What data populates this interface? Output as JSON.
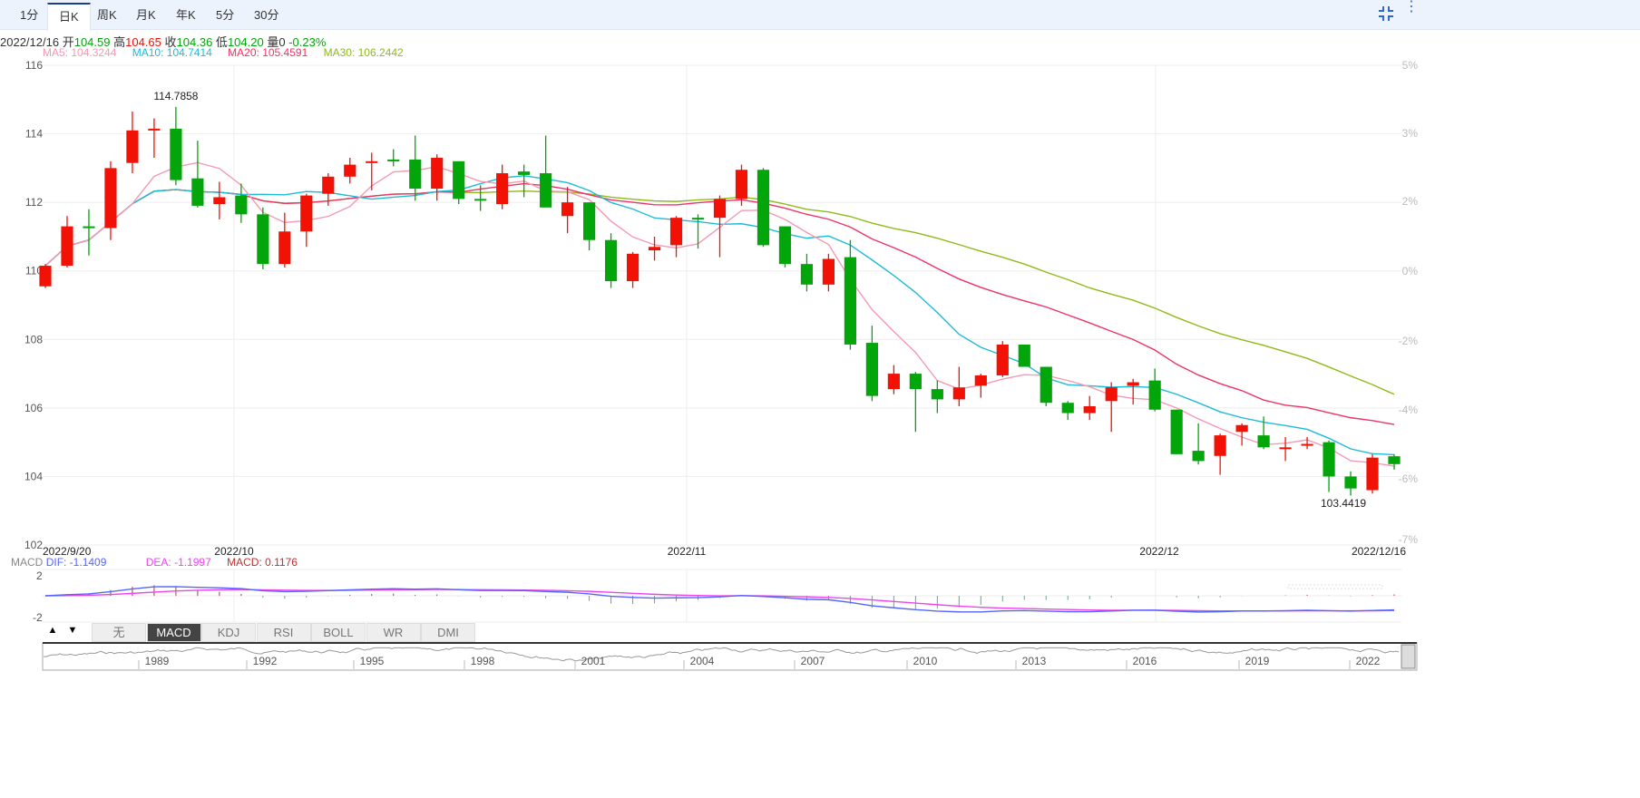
{
  "tabs": [
    "1分",
    "日K",
    "周K",
    "月K",
    "年K",
    "5分",
    "30分"
  ],
  "active_tab": "日K",
  "info": {
    "date": "2022/12/16",
    "open_label": "开",
    "open": "104.59",
    "high_label": "高",
    "high": "104.65",
    "close_label": "收",
    "close": "104.36",
    "low_label": "低",
    "low": "104.20",
    "vol_label": "量",
    "vol": "0",
    "change": "-0.23%"
  },
  "ma": {
    "ma5": "MA5: 104.3244",
    "ma10": "MA10: 104.7414",
    "ma20": "MA20: 105.4591",
    "ma30": "MA30: 106.2442"
  },
  "colors": {
    "up": "#f21205",
    "down": "#02a60b",
    "ma5": "#f59ab2",
    "ma10": "#1ebbd9",
    "ma20": "#ee3366",
    "ma30": "#8fba1a",
    "dif": "#5566ff",
    "dea": "#ee44ee"
  },
  "chart_data": {
    "type": "candlestick",
    "y_ticks": [
      "116",
      "114",
      "112",
      "110",
      "108",
      "106",
      "104",
      "102"
    ],
    "ylim": [
      102,
      116
    ],
    "pct_ticks": [
      "5%",
      "3%",
      "2%",
      "0%",
      "-2%",
      "-4%",
      "-6%",
      "-7%"
    ],
    "x_labels": [
      "2022/9/20",
      "2022/10",
      "2022/11",
      "2022/12",
      "2022/12/16"
    ],
    "max_label": "114.7858",
    "min_label": "103.4419",
    "ohlc": [
      [
        109.55,
        110.2,
        109.5,
        110.15
      ],
      [
        110.15,
        111.6,
        110.1,
        111.3
      ],
      [
        111.3,
        111.8,
        110.45,
        111.25
      ],
      [
        111.25,
        113.2,
        110.9,
        113.0
      ],
      [
        113.15,
        114.65,
        112.85,
        114.1
      ],
      [
        114.1,
        114.45,
        113.3,
        114.15
      ],
      [
        114.15,
        114.7858,
        112.5,
        112.65
      ],
      [
        112.7,
        113.8,
        111.85,
        111.9
      ],
      [
        111.95,
        112.6,
        111.5,
        112.15
      ],
      [
        112.2,
        112.55,
        111.4,
        111.65
      ],
      [
        111.65,
        111.85,
        110.05,
        110.2
      ],
      [
        110.2,
        111.7,
        110.1,
        111.15
      ],
      [
        111.15,
        112.25,
        110.7,
        112.2
      ],
      [
        112.25,
        112.85,
        111.9,
        112.75
      ],
      [
        112.75,
        113.3,
        112.55,
        113.1
      ],
      [
        113.15,
        113.45,
        112.35,
        113.2
      ],
      [
        113.25,
        113.55,
        113.05,
        113.2
      ],
      [
        113.25,
        113.95,
        112.05,
        112.4
      ],
      [
        112.4,
        113.4,
        112.05,
        113.3
      ],
      [
        113.2,
        113.2,
        111.95,
        112.1
      ],
      [
        112.1,
        112.5,
        111.75,
        112.05
      ],
      [
        111.95,
        113.1,
        111.8,
        112.85
      ],
      [
        112.9,
        113.1,
        112.15,
        112.8
      ],
      [
        112.85,
        113.95,
        112.0,
        111.85
      ],
      [
        111.6,
        112.45,
        111.1,
        112.0
      ],
      [
        112.0,
        112.0,
        110.6,
        110.9
      ],
      [
        110.9,
        111.1,
        109.5,
        109.7
      ],
      [
        109.7,
        110.55,
        109.5,
        110.5
      ],
      [
        110.6,
        111.0,
        110.3,
        110.7
      ],
      [
        110.75,
        111.6,
        110.4,
        111.55
      ],
      [
        111.55,
        111.65,
        110.65,
        111.5
      ],
      [
        111.55,
        112.2,
        110.4,
        112.1
      ],
      [
        112.1,
        113.1,
        111.9,
        112.95
      ],
      [
        112.95,
        113.0,
        110.7,
        110.75
      ],
      [
        111.3,
        111.3,
        110.1,
        110.2
      ],
      [
        110.2,
        110.5,
        109.4,
        109.6
      ],
      [
        109.6,
        110.5,
        109.4,
        110.35
      ],
      [
        110.4,
        110.9,
        107.7,
        107.85
      ],
      [
        107.9,
        108.4,
        106.2,
        106.35
      ],
      [
        106.55,
        107.25,
        106.4,
        107.0
      ],
      [
        107.0,
        107.05,
        105.3,
        106.55
      ],
      [
        106.55,
        106.8,
        105.85,
        106.25
      ],
      [
        106.25,
        107.2,
        106.05,
        106.6
      ],
      [
        106.65,
        107.0,
        106.3,
        106.95
      ],
      [
        106.95,
        107.95,
        106.9,
        107.85
      ],
      [
        107.85,
        107.85,
        107.2,
        107.2
      ],
      [
        107.2,
        107.2,
        106.05,
        106.15
      ],
      [
        106.15,
        106.2,
        105.65,
        105.85
      ],
      [
        105.85,
        106.35,
        105.65,
        106.05
      ],
      [
        106.2,
        106.75,
        105.3,
        106.6
      ],
      [
        106.65,
        106.85,
        106.1,
        106.75
      ],
      [
        106.8,
        107.15,
        105.9,
        105.95
      ],
      [
        105.95,
        105.95,
        104.65,
        104.65
      ],
      [
        104.75,
        105.55,
        104.35,
        104.45
      ],
      [
        104.6,
        105.25,
        104.05,
        105.2
      ],
      [
        105.3,
        105.55,
        104.9,
        105.5
      ],
      [
        105.2,
        105.75,
        104.8,
        104.85
      ],
      [
        104.8,
        105.15,
        104.45,
        104.85
      ],
      [
        104.9,
        105.15,
        104.8,
        104.95
      ],
      [
        105.0,
        105.05,
        103.55,
        104.0
      ],
      [
        104.0,
        104.15,
        103.4419,
        103.65
      ],
      [
        103.6,
        104.65,
        103.5,
        104.55
      ],
      [
        104.59,
        104.65,
        104.2,
        104.36
      ]
    ]
  },
  "macd": {
    "label": "MACD",
    "dif": "DIF: -1.1409",
    "dea": "DEA: -1.1997",
    "macd": "MACD: 0.1176",
    "ticks": [
      "2",
      "-2"
    ]
  },
  "indicator_tabs": [
    "无",
    "MACD",
    "KDJ",
    "RSI",
    "BOLL",
    "WR",
    "DMI"
  ],
  "active_indicator": "MACD",
  "navigator_years": [
    "1989",
    "1992",
    "1995",
    "1998",
    "2001",
    "2004",
    "2007",
    "2010",
    "2013",
    "2016",
    "2019",
    "2022"
  ]
}
